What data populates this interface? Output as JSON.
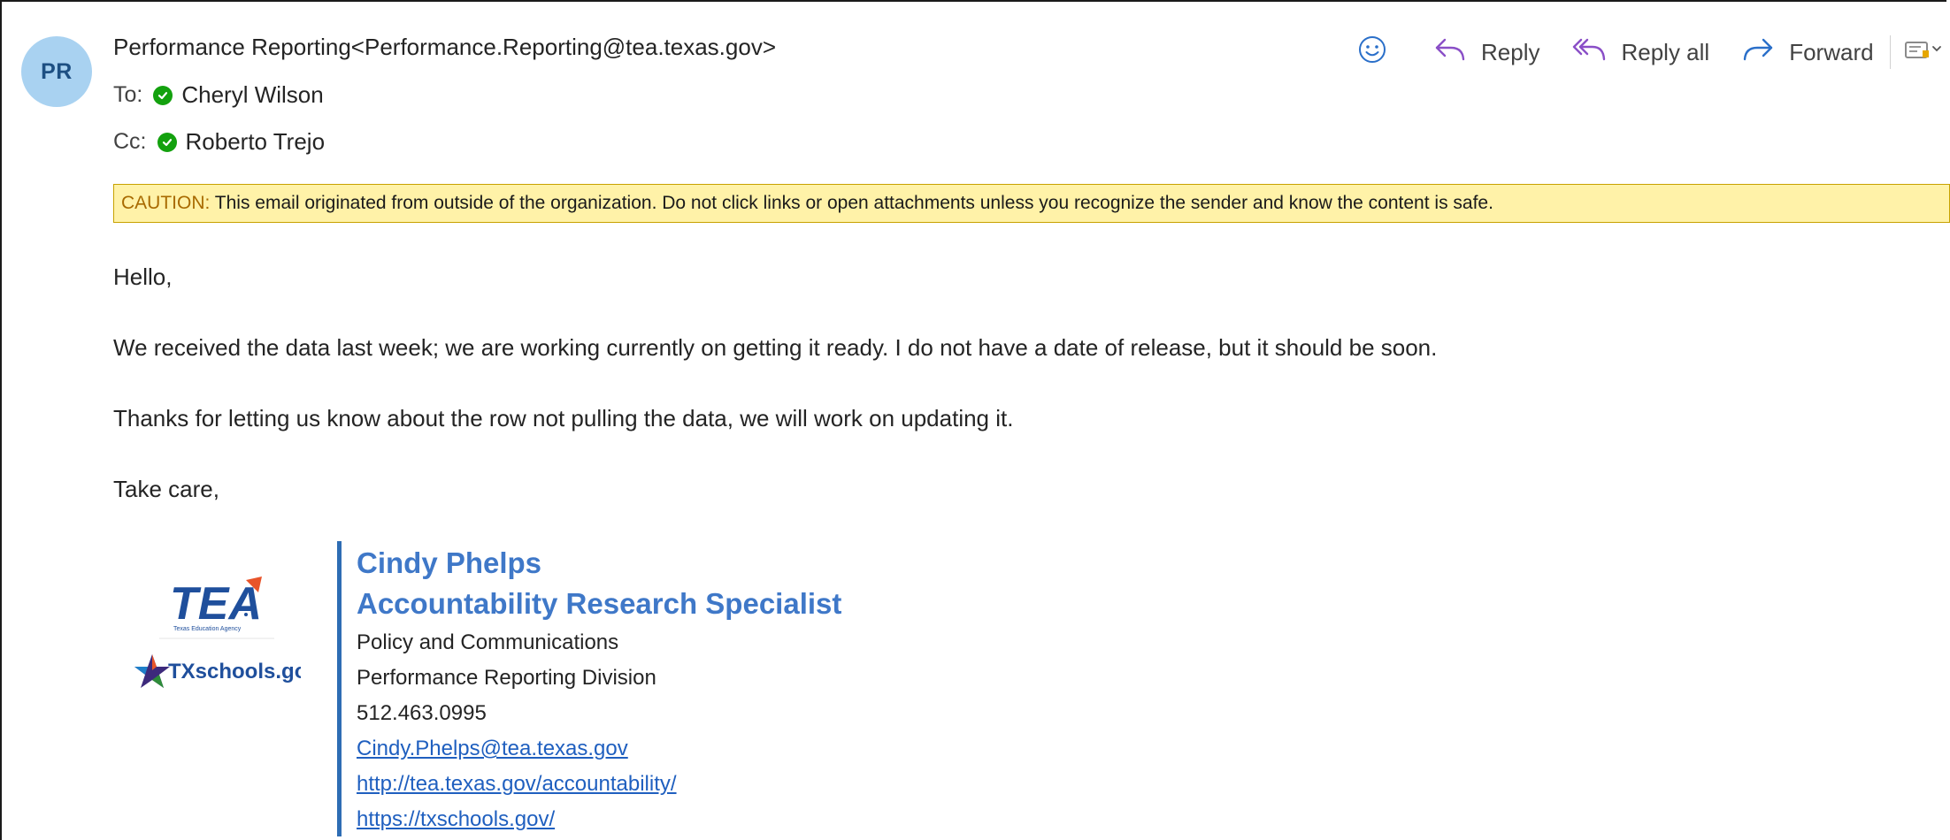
{
  "sender": {
    "initials": "PR",
    "display": "Performance Reporting<Performance.Reporting@tea.texas.gov>"
  },
  "to": {
    "label": "To:",
    "name": "Cheryl Wilson"
  },
  "cc": {
    "label": "Cc:",
    "name": "Roberto Trejo"
  },
  "toolbar": {
    "reply_label": "Reply",
    "reply_all_label": "Reply all",
    "forward_label": "Forward",
    "icons": [
      "emoji-icon",
      "reply-icon",
      "reply-all-icon",
      "forward-icon",
      "more-actions-icon"
    ]
  },
  "caution": {
    "tag": "CAUTION:",
    "text": " This email originated from outside of the organization. Do not click links or open attachments unless you recognize the sender and know the content is safe."
  },
  "body": {
    "greeting": "Hello,",
    "para1": "We received the data last week; we are working currently on getting it ready.  I do not have a date of release, but it should be soon.",
    "para2": "Thanks for letting us know about the row not pulling the data, we will work on updating it.",
    "closing": "Take care,"
  },
  "signature": {
    "name": "Cindy Phelps",
    "title": "Accountability Research Specialist",
    "dept": "Policy and Communications",
    "division": "Performance Reporting Division",
    "phone": "512.463.0995",
    "email": "Cindy.Phelps@tea.texas.gov",
    "url1": "http://tea.texas.gov/accountability/",
    "url2": "https://txschools.gov/",
    "logo_text": "TEA",
    "logo_subtext": "Texas Education Agency",
    "logo2_text": "TXschools.gov"
  },
  "colors": {
    "avatar_bg": "#a9d2f1",
    "accent_blue": "#3f78c8",
    "caution_bg": "#fff2a8",
    "presence_green": "#13a10e"
  }
}
